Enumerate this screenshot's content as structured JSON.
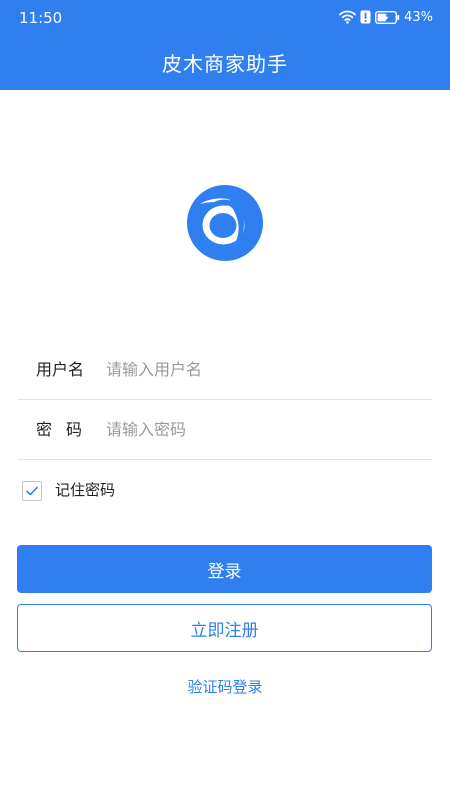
{
  "status_bar": {
    "time": "11:50",
    "battery": "43%",
    "icons": [
      "wifi-icon",
      "alert-icon",
      "battery-icon"
    ]
  },
  "app_bar": {
    "title": "皮木商家助手"
  },
  "logo": {
    "icon": "app-logo-icon",
    "color": "#2f7ff0"
  },
  "form": {
    "username": {
      "label": "用户名",
      "value": "",
      "placeholder": "请输入用户名"
    },
    "password": {
      "label": "密码",
      "value": "",
      "placeholder": "请输入密码"
    },
    "remember": {
      "label": "记住密码",
      "checked": true
    }
  },
  "actions": {
    "login_label": "登录",
    "register_label": "立即注册",
    "sms_login_label": "验证码登录"
  },
  "colors": {
    "primary": "#2f7ff0",
    "text": "#222222",
    "placeholder": "#9a9a9a",
    "divider": "#e3e3e3"
  }
}
